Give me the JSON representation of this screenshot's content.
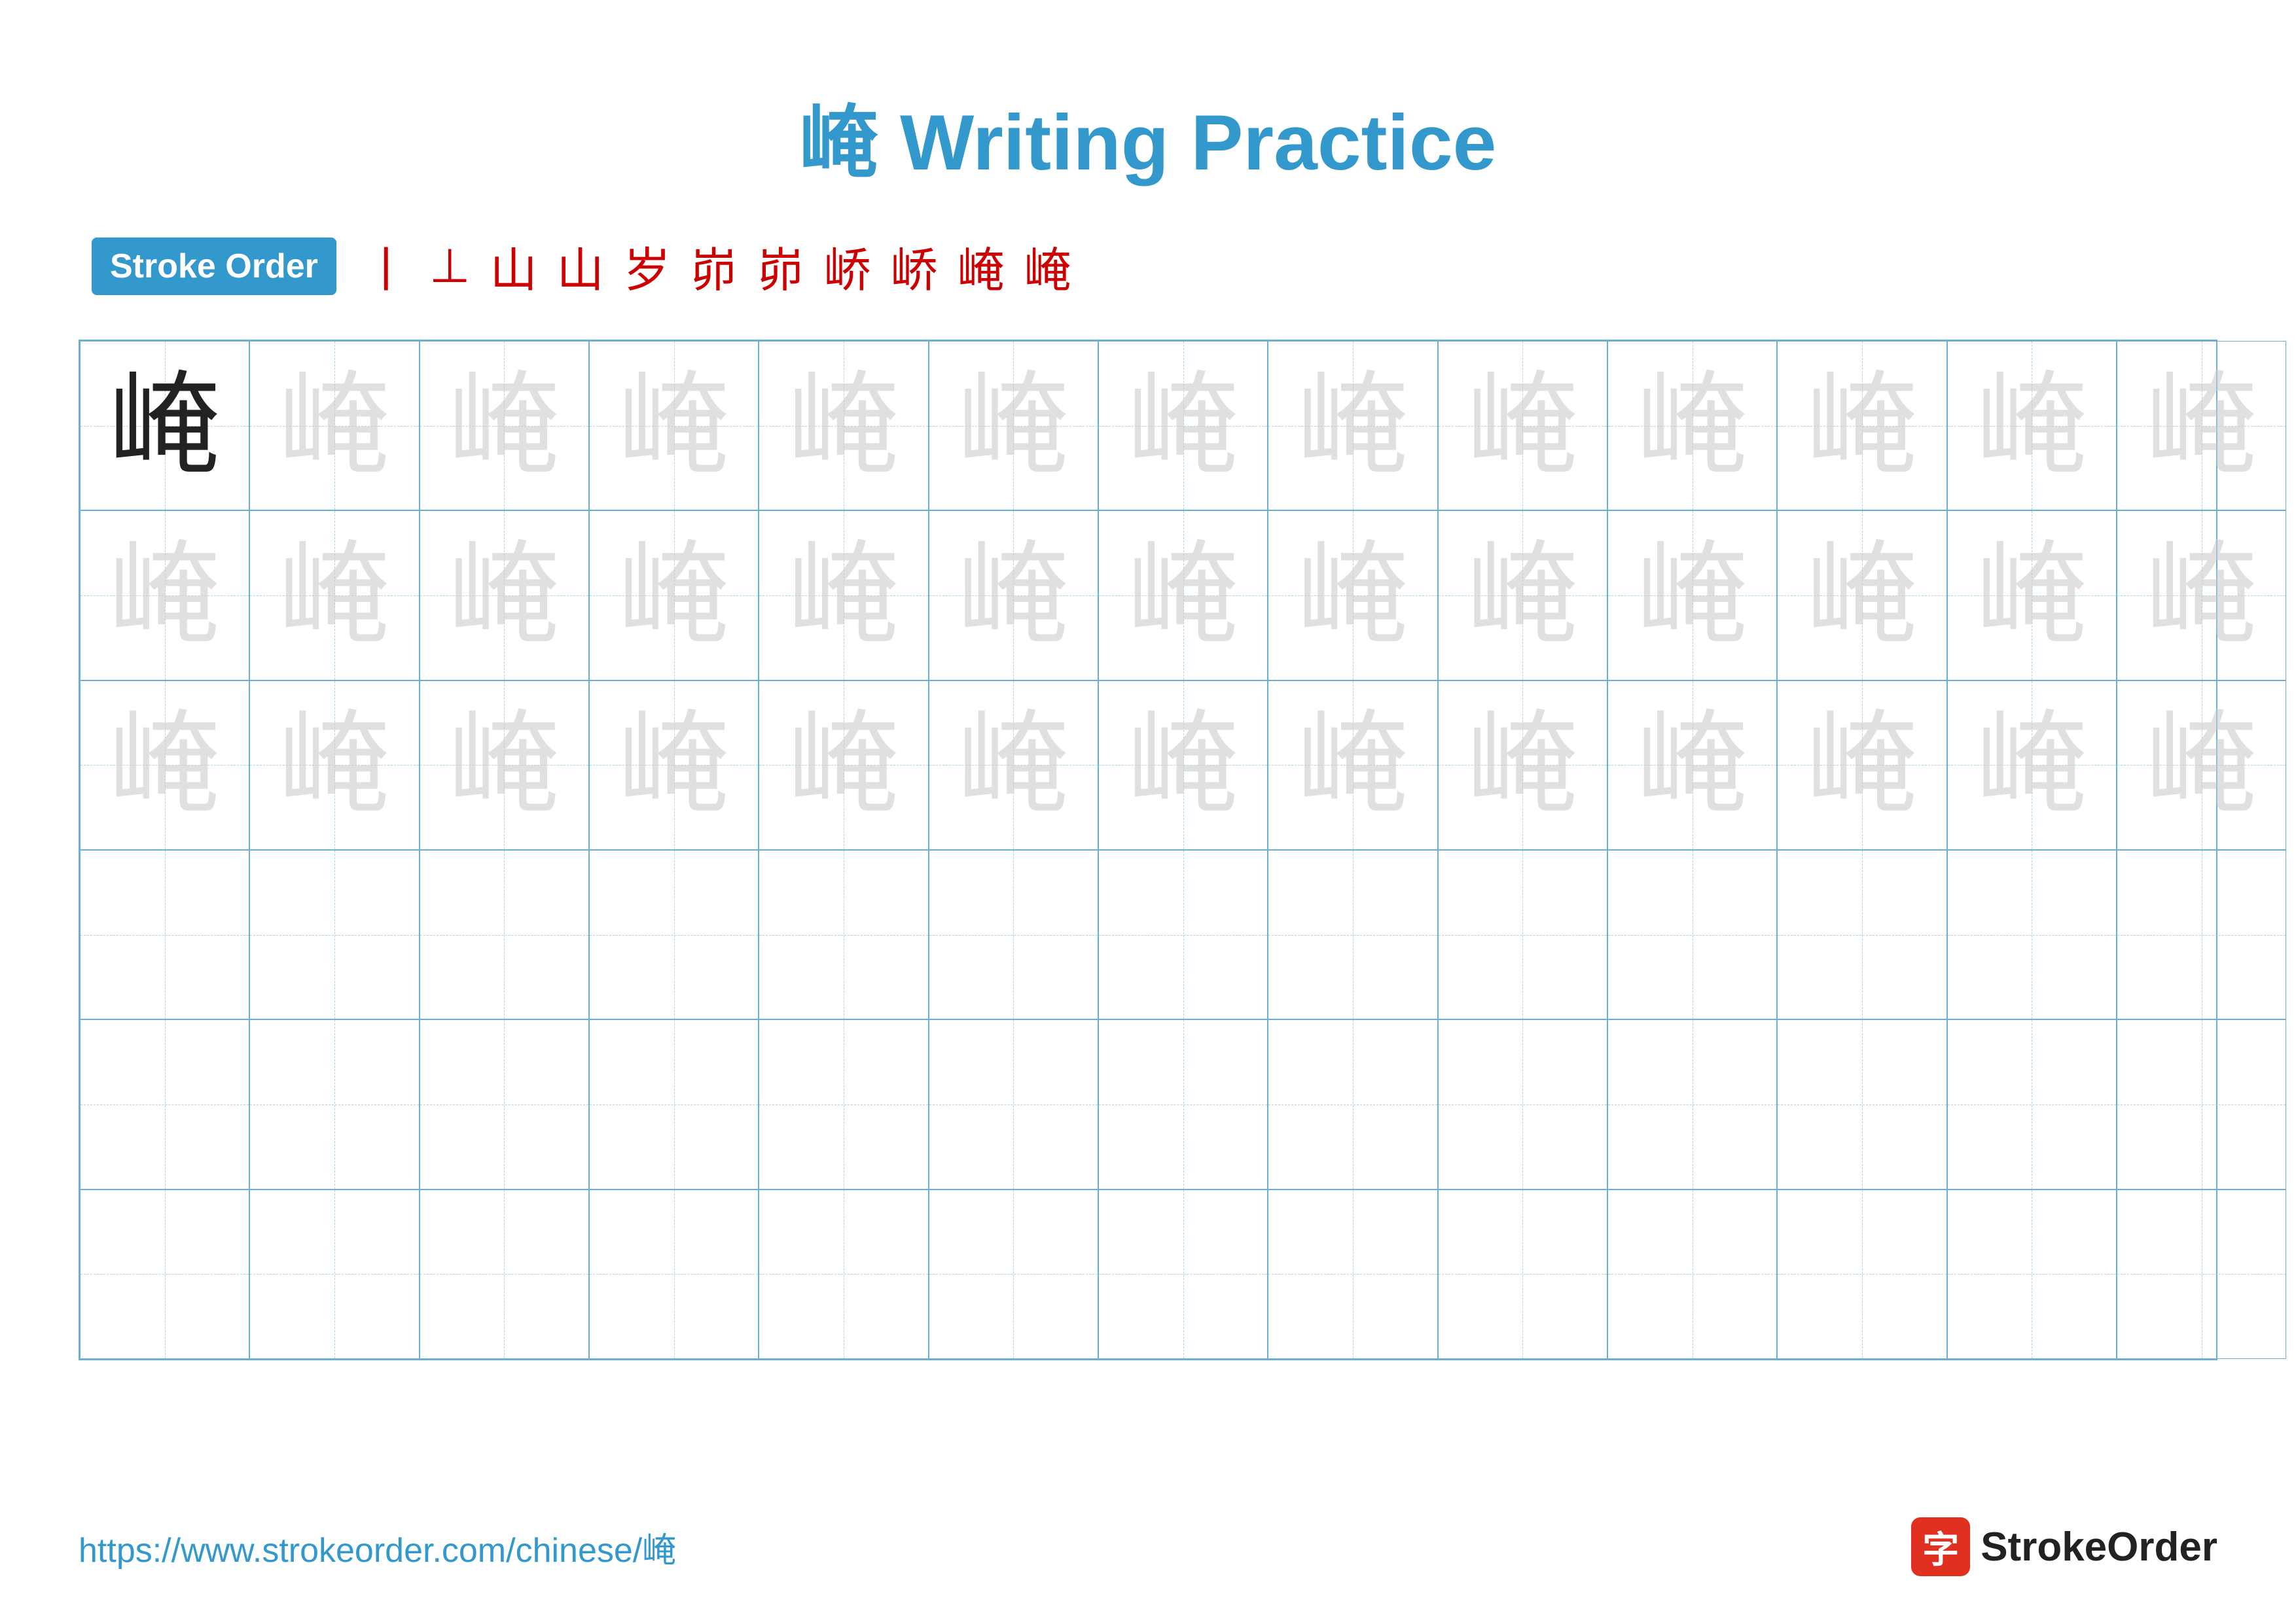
{
  "title": {
    "chinese_char": "崦",
    "label": "Writing Practice",
    "full_title": "崦 Writing Practice"
  },
  "stroke_order": {
    "badge_label": "Stroke Order",
    "strokes": [
      "丨",
      "⊥",
      "山",
      "山一",
      "山卜",
      "岁",
      "岁",
      "峁",
      "峁",
      "崦",
      "崦"
    ]
  },
  "grid": {
    "cols": 13,
    "rows": 6,
    "character": "崦",
    "solid_count": 1,
    "faded_rows": 3,
    "empty_rows": 3
  },
  "footer": {
    "url": "https://www.strokeorder.com/chinese/崦",
    "logo_char": "字",
    "logo_name": "StrokeOrder"
  }
}
